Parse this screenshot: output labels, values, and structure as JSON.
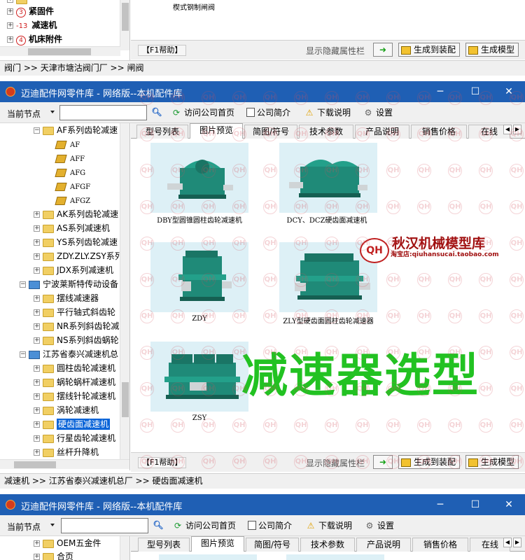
{
  "top_window": {
    "tree": [
      {
        "label": "紧固件",
        "number": "3"
      },
      {
        "label": "减速机",
        "number": "13"
      },
      {
        "label": "机床附件",
        "number": "4"
      }
    ],
    "content_caption": "楔式钢制闸阀",
    "status": {
      "help": "【F1帮助】",
      "hidden_attr": "显示隐藏属性栏",
      "assembly": "生成到装配",
      "model": "生成模型"
    },
    "breadcrumb": "阀门 >> 天津市塘沽阀门厂 >> 闸阀"
  },
  "main_window": {
    "title": "迈迪配件网零件库 - 网络版--本机配件库",
    "controls": {
      "minimize": "─",
      "maximize": "☐",
      "close": "✕"
    },
    "toolbar": {
      "current_node": "当前节点",
      "visit": "访问公司首页",
      "profile": "公司简介",
      "download": "下载说明",
      "settings": "设置"
    },
    "tree": [
      {
        "label": "AF系列齿轮减速",
        "icon": "folder",
        "level": 2
      },
      {
        "label": "AF",
        "icon": "part",
        "level": 3
      },
      {
        "label": "AFF",
        "icon": "part",
        "level": 3
      },
      {
        "label": "AFG",
        "icon": "part",
        "level": 3
      },
      {
        "label": "AFGF",
        "icon": "part",
        "level": 3
      },
      {
        "label": "AFGZ",
        "icon": "part",
        "level": 3
      },
      {
        "label": "AK系列齿轮减速",
        "icon": "folder",
        "level": 2
      },
      {
        "label": "AS系列减速机",
        "icon": "folder",
        "level": 2
      },
      {
        "label": "YS系列齿轮减速",
        "icon": "folder",
        "level": 2
      },
      {
        "label": "ZDY.ZLY.ZSY系列",
        "icon": "folder",
        "level": 2
      },
      {
        "label": "JDX系列减速机",
        "icon": "folder",
        "level": 2
      },
      {
        "label": "宁波莱斯特传动设备",
        "icon": "pc",
        "level": 1
      },
      {
        "label": "摆线减速器",
        "icon": "folder",
        "level": 2
      },
      {
        "label": "平行轴式斜齿轮",
        "icon": "folder",
        "level": 2
      },
      {
        "label": "NR系列斜齿轮减",
        "icon": "folder",
        "level": 2
      },
      {
        "label": "NS系列斜齿蜗轮",
        "icon": "folder",
        "level": 2
      },
      {
        "label": "江苏省泰兴减速机总",
        "icon": "pc",
        "level": 1
      },
      {
        "label": "圆柱齿轮减速机",
        "icon": "folder",
        "level": 2
      },
      {
        "label": "蜗轮蜗杆减速机",
        "icon": "folder",
        "level": 2
      },
      {
        "label": "摆线针轮减速机",
        "icon": "folder",
        "level": 2
      },
      {
        "label": "涡轮减速机",
        "icon": "folder",
        "level": 2
      },
      {
        "label": "硬齿面减速机",
        "icon": "folder",
        "level": 2,
        "selected": true
      },
      {
        "label": "行星齿轮减速机",
        "icon": "folder",
        "level": 2
      },
      {
        "label": "丝杆升降机",
        "icon": "folder",
        "level": 2
      }
    ],
    "tabs": [
      "型号列表",
      "图片预览",
      "简图/符号",
      "技术参数",
      "产品说明",
      "销售价格",
      "在线"
    ],
    "active_tab": "图片预览",
    "products": [
      {
        "caption": "DBY型圆锥圆柱齿轮减速机"
      },
      {
        "caption": "DCY、DCZ硬齿面减速机"
      },
      {
        "caption": "ZDY"
      },
      {
        "caption": "ZLY型硬齿面圆柱齿轮减速器"
      },
      {
        "caption": "ZSY"
      }
    ],
    "overlay": {
      "shop_logo": "QH",
      "shop_name": "秋汉机械模型库",
      "shop_sub": "淘宝店:qiuhansucai.taobao.com",
      "promo": "减速器选型",
      "watermark": "QH"
    },
    "status": {
      "help": "【F1帮助】",
      "hidden_attr": "显示隐藏属性栏",
      "assembly": "生成到装配",
      "model": "生成模型"
    },
    "breadcrumb": "减速机 >> 江苏省泰兴减速机总厂 >> 硬齿面减速机"
  },
  "bottom_window": {
    "title": "迈迪配件网零件库 - 网络版--本机配件库",
    "toolbar": {
      "current_node": "当前节点",
      "visit": "访问公司首页",
      "profile": "公司简介",
      "download": "下载说明",
      "settings": "设置"
    },
    "tree": [
      {
        "label": "OEM五金件"
      },
      {
        "label": "合页"
      }
    ],
    "tabs": [
      "型号列表",
      "图片预览",
      "简图/符号",
      "技术参数",
      "产品说明",
      "销售价格",
      "在线"
    ]
  },
  "colors": {
    "titlebar": "#1f5fb4",
    "promo": "#22c222",
    "shop": "#a01010",
    "product_bg": "#ddf0f6",
    "gearbox": "#1f8a78"
  }
}
